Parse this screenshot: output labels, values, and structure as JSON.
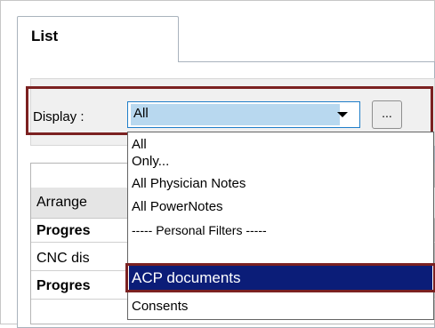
{
  "tab": {
    "label": "List"
  },
  "display": {
    "label": "Display :",
    "selected": "All",
    "more_button": "..."
  },
  "grid": {
    "header": "Arrange",
    "rows": [
      "Progres",
      "CNC dis",
      "Progres"
    ]
  },
  "dropdown": {
    "options": [
      "All",
      "Only...",
      "All Physician Notes",
      "All PowerNotes",
      "----- Personal Filters -----",
      "ACP documents",
      "Consents"
    ],
    "selected_index": 5
  },
  "colors": {
    "highlight_box": "#7b2121",
    "selection_bg": "#0b1d78",
    "combo_border": "#1f7ec9",
    "combo_fill": "#b8d8ef"
  },
  "icons": {
    "combo_arrow": "triangle-down-icon"
  }
}
